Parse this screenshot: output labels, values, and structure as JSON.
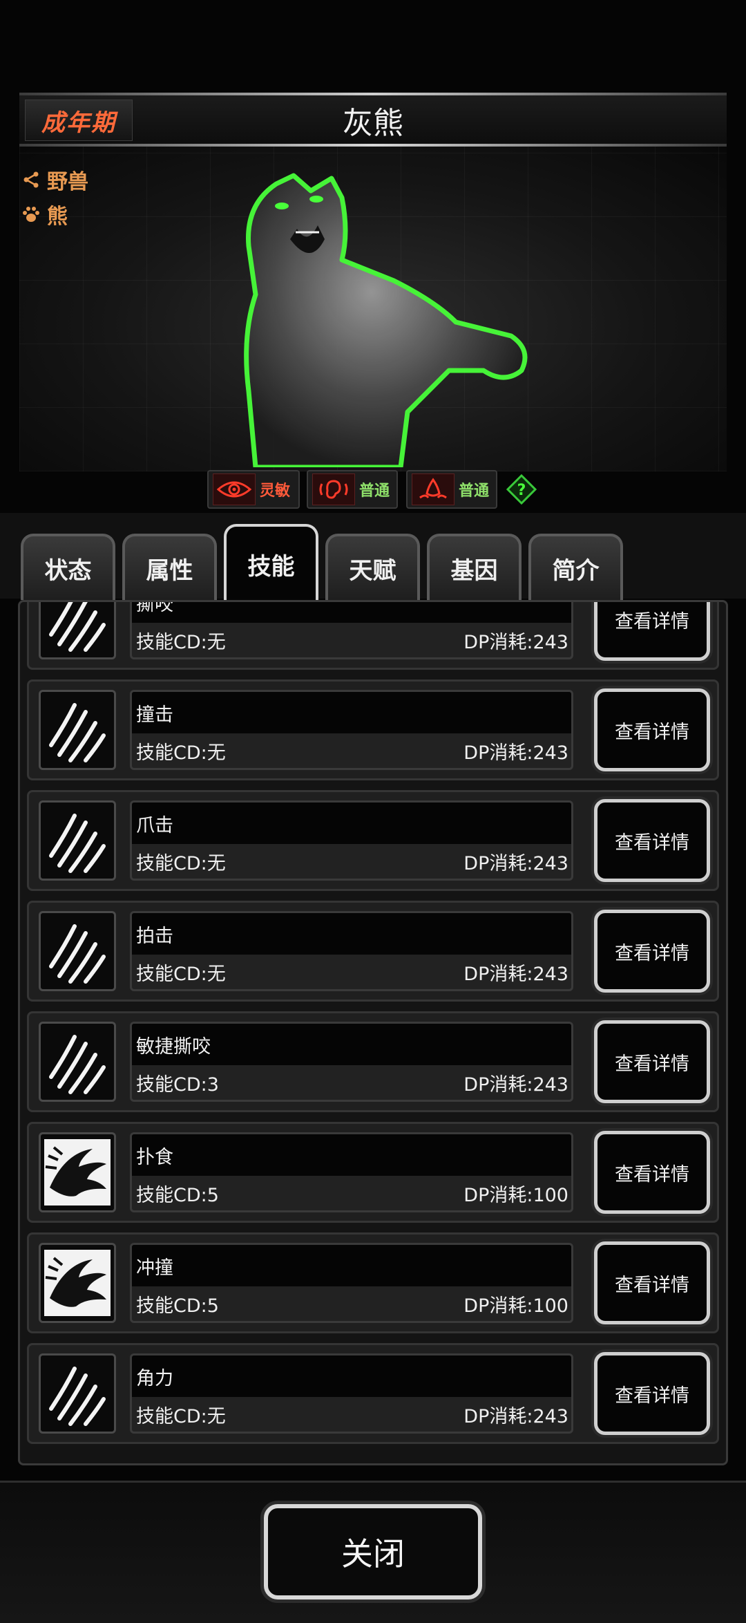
{
  "header": {
    "stage": "成年期",
    "title": "灰熊"
  },
  "tags": [
    {
      "icon": "share-icon",
      "label": "野兽"
    },
    {
      "icon": "paw-icon",
      "label": "熊"
    }
  ],
  "stats": [
    {
      "icon": "eye-icon",
      "label": "灵敏",
      "color": "#ff5a3a"
    },
    {
      "icon": "ear-icon",
      "label": "普通",
      "color": "#8fe06a"
    },
    {
      "icon": "nose-icon",
      "label": "普通",
      "color": "#8fe06a"
    }
  ],
  "help_icon": "question-icon",
  "tabs": [
    {
      "label": "状态",
      "active": false
    },
    {
      "label": "属性",
      "active": false
    },
    {
      "label": "技能",
      "active": true
    },
    {
      "label": "天赋",
      "active": false
    },
    {
      "label": "基因",
      "active": false
    },
    {
      "label": "简介",
      "active": false
    }
  ],
  "skills": [
    {
      "name": "撕咬",
      "cd": "技能CD:无",
      "dp": "DP消耗:243",
      "icon": "claw-icon",
      "button": "查看详情"
    },
    {
      "name": "撞击",
      "cd": "技能CD:无",
      "dp": "DP消耗:243",
      "icon": "claw-icon",
      "button": "查看详情"
    },
    {
      "name": "爪击",
      "cd": "技能CD:无",
      "dp": "DP消耗:243",
      "icon": "claw-icon",
      "button": "查看详情"
    },
    {
      "name": "拍击",
      "cd": "技能CD:无",
      "dp": "DP消耗:243",
      "icon": "claw-icon",
      "button": "查看详情"
    },
    {
      "name": "敏捷撕咬",
      "cd": "技能CD:3",
      "dp": "DP消耗:243",
      "icon": "claw-icon",
      "button": "查看详情"
    },
    {
      "name": "扑食",
      "cd": "技能CD:5",
      "dp": "DP消耗:100",
      "icon": "pounce-icon",
      "button": "查看详情"
    },
    {
      "name": "冲撞",
      "cd": "技能CD:5",
      "dp": "DP消耗:100",
      "icon": "pounce-icon",
      "button": "查看详情"
    },
    {
      "name": "角力",
      "cd": "技能CD:无",
      "dp": "DP消耗:243",
      "icon": "claw-icon",
      "button": "查看详情"
    }
  ],
  "footer": {
    "close_label": "关闭"
  }
}
